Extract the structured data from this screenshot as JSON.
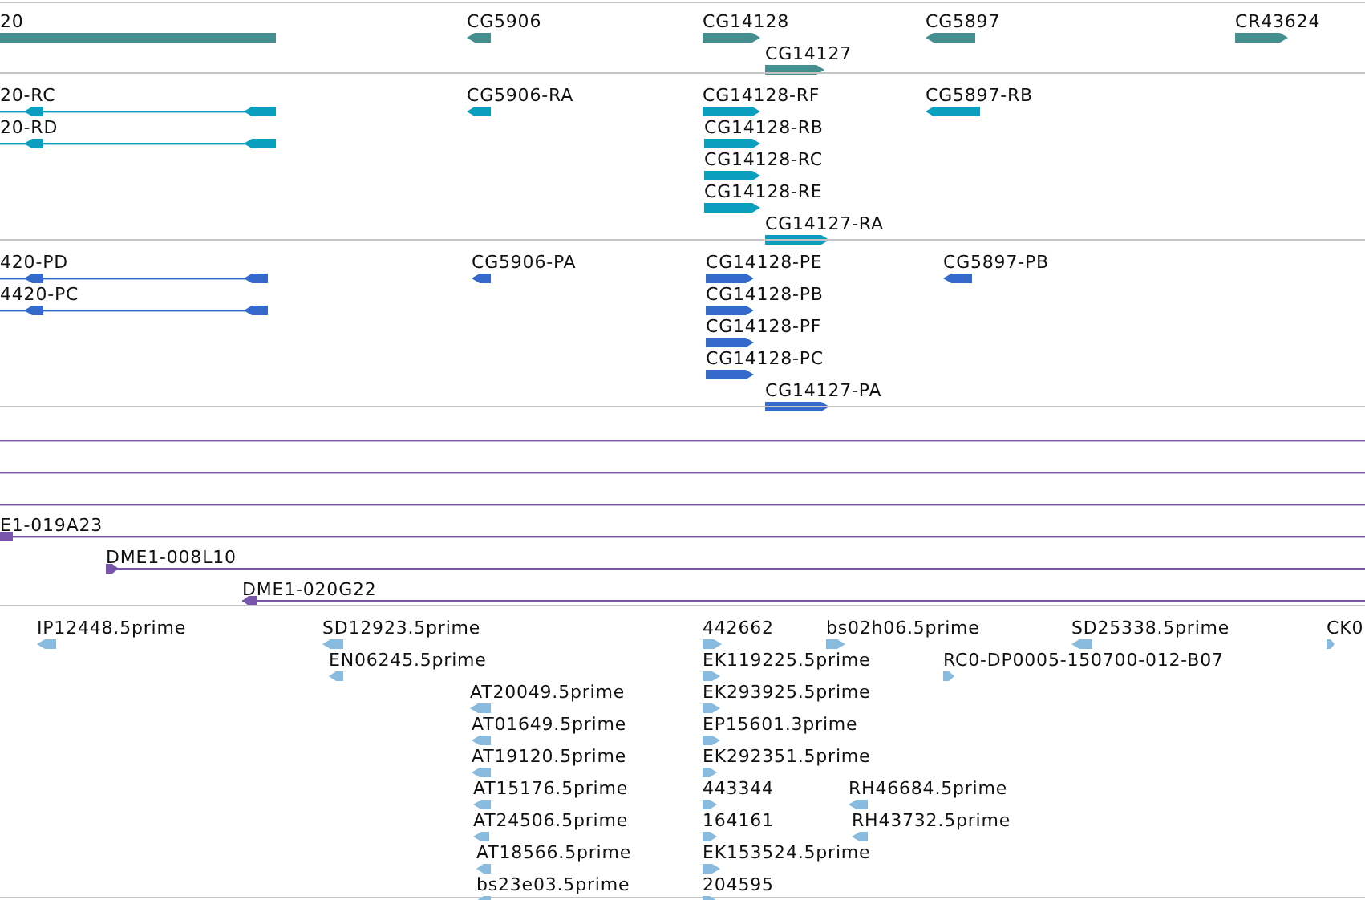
{
  "tracks": [
    {
      "color": "#468f91",
      "items": [
        {
          "label": "20"
        },
        {
          "label": "CG5906",
          "reverse": true
        },
        {
          "label": "CG14128",
          "reverse": false
        },
        {
          "label": "CG14127",
          "reverse": false
        },
        {
          "label": "CG5897",
          "reverse": true
        },
        {
          "label": "CR43624",
          "reverse": false
        }
      ]
    },
    {
      "color": "#0a9fbf",
      "items": [
        {
          "label": "20-RC",
          "reverse": true
        },
        {
          "label": "20-RD",
          "reverse": true
        },
        {
          "label": "CG5906-RA",
          "reverse": true
        },
        {
          "label": "CG14128-RF",
          "reverse": false
        },
        {
          "label": "CG14128-RB",
          "reverse": false
        },
        {
          "label": "CG14128-RC",
          "reverse": false
        },
        {
          "label": "CG14128-RE",
          "reverse": false
        },
        {
          "label": "CG14127-RA",
          "reverse": false
        },
        {
          "label": "CG5897-RB",
          "reverse": true
        }
      ]
    },
    {
      "color": "#3569cc",
      "items": [
        {
          "label": "420-PD",
          "reverse": true
        },
        {
          "label": "4420-PC",
          "reverse": true
        },
        {
          "label": "CG5906-PA",
          "reverse": true
        },
        {
          "label": "CG14128-PE",
          "reverse": false
        },
        {
          "label": "CG14128-PB",
          "reverse": false
        },
        {
          "label": "CG14128-PF",
          "reverse": false
        },
        {
          "label": "CG14128-PC",
          "reverse": false
        },
        {
          "label": "CG14127-PA",
          "reverse": false
        },
        {
          "label": "CG5897-PB",
          "reverse": true
        }
      ]
    },
    {
      "color": "#7755aa",
      "items": [
        {
          "label": "E1-019A23"
        },
        {
          "label": "DME1-008L10",
          "reverse": false
        },
        {
          "label": "DME1-020G22",
          "reverse": true
        }
      ]
    },
    {
      "color": "#88bbdd",
      "items": [
        {
          "label": "IP12448.5prime",
          "reverse": true
        },
        {
          "label": "SD12923.5prime",
          "reverse": true
        },
        {
          "label": "442662",
          "reverse": false
        },
        {
          "label": "bs02h06.5prime",
          "reverse": false
        },
        {
          "label": "SD25338.5prime",
          "reverse": true
        },
        {
          "label": "CK0",
          "reverse": false
        },
        {
          "label": "EN06245.5prime",
          "reverse": true
        },
        {
          "label": "EK119225.5prime",
          "reverse": false
        },
        {
          "label": "RC0-DP0005-150700-012-B07",
          "reverse": false
        },
        {
          "label": "AT20049.5prime",
          "reverse": true
        },
        {
          "label": "EK293925.5prime",
          "reverse": false
        },
        {
          "label": "AT01649.5prime",
          "reverse": true
        },
        {
          "label": "EP15601.3prime",
          "reverse": false
        },
        {
          "label": "AT19120.5prime",
          "reverse": true
        },
        {
          "label": "EK292351.5prime",
          "reverse": false
        },
        {
          "label": "AT15176.5prime",
          "reverse": true
        },
        {
          "label": "443344",
          "reverse": false
        },
        {
          "label": "RH46684.5prime",
          "reverse": true
        },
        {
          "label": "AT24506.5prime",
          "reverse": true
        },
        {
          "label": "164161",
          "reverse": false
        },
        {
          "label": "RH43732.5prime",
          "reverse": true
        },
        {
          "label": "AT18566.5prime",
          "reverse": true
        },
        {
          "label": "EK153524.5prime",
          "reverse": false
        },
        {
          "label": "bs23e03.5prime",
          "reverse": true
        },
        {
          "label": "204595",
          "reverse": false
        }
      ]
    }
  ]
}
